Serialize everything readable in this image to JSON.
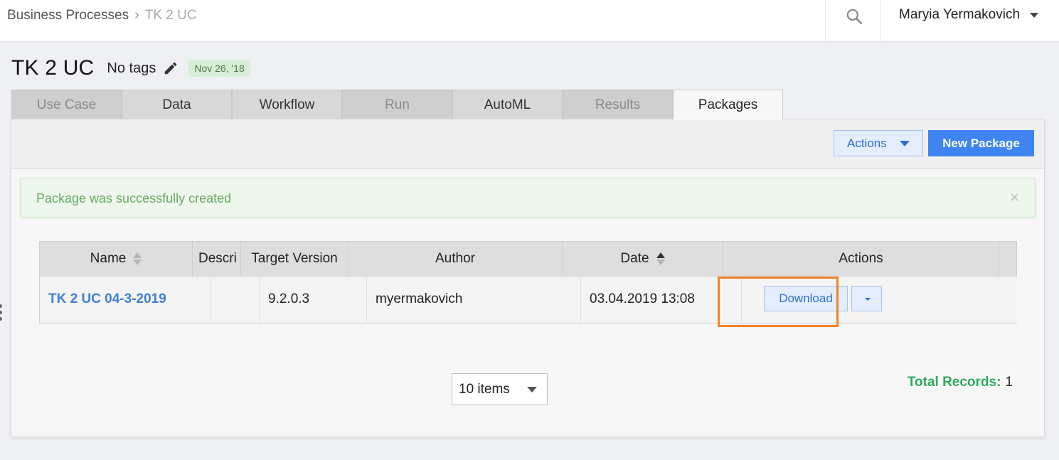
{
  "breadcrumb": {
    "parent": "Business Processes",
    "current": "TK 2 UC"
  },
  "user": {
    "name": "Maryia Yermakovich"
  },
  "title": {
    "name": "TK 2 UC",
    "tags": "No tags",
    "date": "Nov 26, '18"
  },
  "tabs": [
    {
      "label": "Use Case",
      "state": "disabled"
    },
    {
      "label": "Data",
      "state": "normal"
    },
    {
      "label": "Workflow",
      "state": "normal"
    },
    {
      "label": "Run",
      "state": "disabled"
    },
    {
      "label": "AutoML",
      "state": "normal"
    },
    {
      "label": "Results",
      "state": "disabled"
    },
    {
      "label": "Packages",
      "state": "active"
    }
  ],
  "toolbar": {
    "actions_label": "Actions",
    "new_package_label": "New Package"
  },
  "alert": {
    "text": "Package was successfully created",
    "close": "×"
  },
  "grid": {
    "headers": [
      "Name",
      "Descri",
      "Target Version",
      "Author",
      "Date",
      "Actions"
    ],
    "rows": [
      {
        "name": "TK 2 UC 04-3-2019",
        "description": "",
        "target_version": "9.2.0.3",
        "author": "myermakovich",
        "date": "03.04.2019 13:08",
        "action": "Download"
      }
    ]
  },
  "pager": {
    "page_size": "10 items",
    "total_label": "Total Records:",
    "total_value": "1"
  },
  "colors": {
    "accent": "#3f84f1",
    "success": "#67a862",
    "highlight": "#f2822a"
  }
}
